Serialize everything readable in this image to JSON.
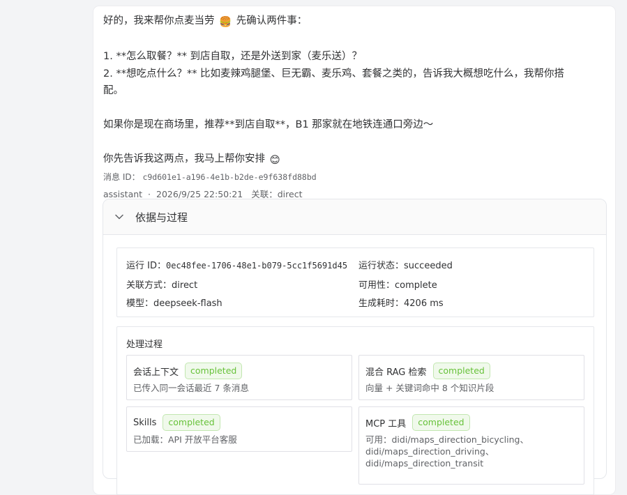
{
  "message": {
    "line1_text": "好的，我来帮你点麦当劳",
    "line1_emoji": "🍔",
    "line1_tail": "先确认两件事：",
    "item1": "1. **怎么取餐？** 到店自取，还是外送到家（麦乐送）？",
    "item2_a": "2. **想吃点什么？** 比如麦辣鸡腿堡、巨无霸、麦乐鸡、套餐之类的，告诉我大概想吃什么，我帮你搭",
    "item2_b": "配。",
    "suggestion": "如果你是现在商场里，推荐**到店自取**，B1 那家就在地铁连通口旁边～",
    "closing_text": "你先告诉我这两点，我马上帮你安排",
    "closing_emoji": "😊"
  },
  "meta": {
    "id_label": "消息 ID：",
    "id_value": "c9d601e1-a196-4e1b-b2de-e9f638fd88bd",
    "role": "assistant",
    "sep": "·",
    "datetime": "2026/9/25 22:50:21",
    "link_label": "关联：",
    "link_value": "direct"
  },
  "panel": {
    "title": "依据与过程",
    "icon": "chevron-down-icon",
    "run": {
      "run_id_label": "运行 ID：",
      "run_id_value": "0ec48fee-1706-48e1-b079-5cc1f5691d45",
      "status_label": "运行状态：",
      "status_value": "succeeded",
      "link_label": "关联方式：",
      "link_value": "direct",
      "avail_label": "可用性：",
      "avail_value": "complete",
      "model_label": "模型：",
      "model_value": "deepseek-flash",
      "time_label": "生成耗时：",
      "time_value": "4206 ms"
    },
    "process": {
      "title": "处理过程",
      "steps": [
        {
          "title": "会话上下文",
          "status": "completed",
          "desc": "已传入同一会话最近 7 条消息"
        },
        {
          "title": "混合 RAG 检索",
          "status": "completed",
          "desc": "向量 + 关键词命中 8 个知识片段"
        },
        {
          "title": "Skills",
          "status": "completed",
          "desc": "已加载：API 开放平台客服"
        },
        {
          "title": "MCP 工具",
          "status": "completed",
          "desc": "可用：didi/maps_direction_bicycling、didi/maps_direction_driving、didi/maps_direction_transit"
        }
      ]
    }
  },
  "colors": {
    "success": "#67c23a",
    "success_bg": "#f0f9eb",
    "text": "#303133",
    "muted": "#606266",
    "border": "#e5e7eb"
  }
}
